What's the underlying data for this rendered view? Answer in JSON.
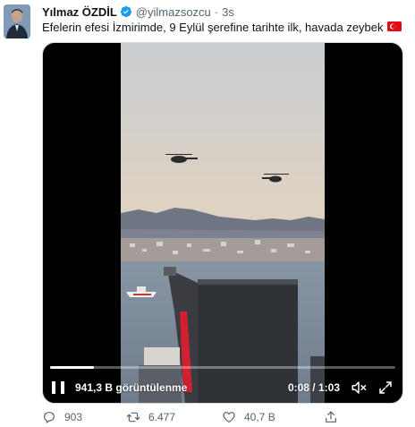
{
  "tweet": {
    "author_name": "Yılmaz ÖZDİL",
    "handle": "@yilmazsozcu",
    "separator": "·",
    "time": "3s",
    "text": "Efelerin efesi İzmirimde, 9 Eylül şerefine tarihte ilk, havada zeybek",
    "flag_icon": "turkey-flag-icon"
  },
  "video": {
    "views_label": "941,3 B görüntülenme",
    "elapsed": "0:08",
    "duration": "1:03",
    "time_display": "0:08 / 1:03",
    "progress_fraction": 0.127
  },
  "actions": {
    "reply_count": "903",
    "retweet_count": "6.477",
    "like_count": "40,7 B"
  },
  "colors": {
    "verified_blue": "#1d9bf0",
    "text_primary": "#0f1419",
    "text_secondary": "#536471",
    "flag_red": "#e30a17"
  }
}
